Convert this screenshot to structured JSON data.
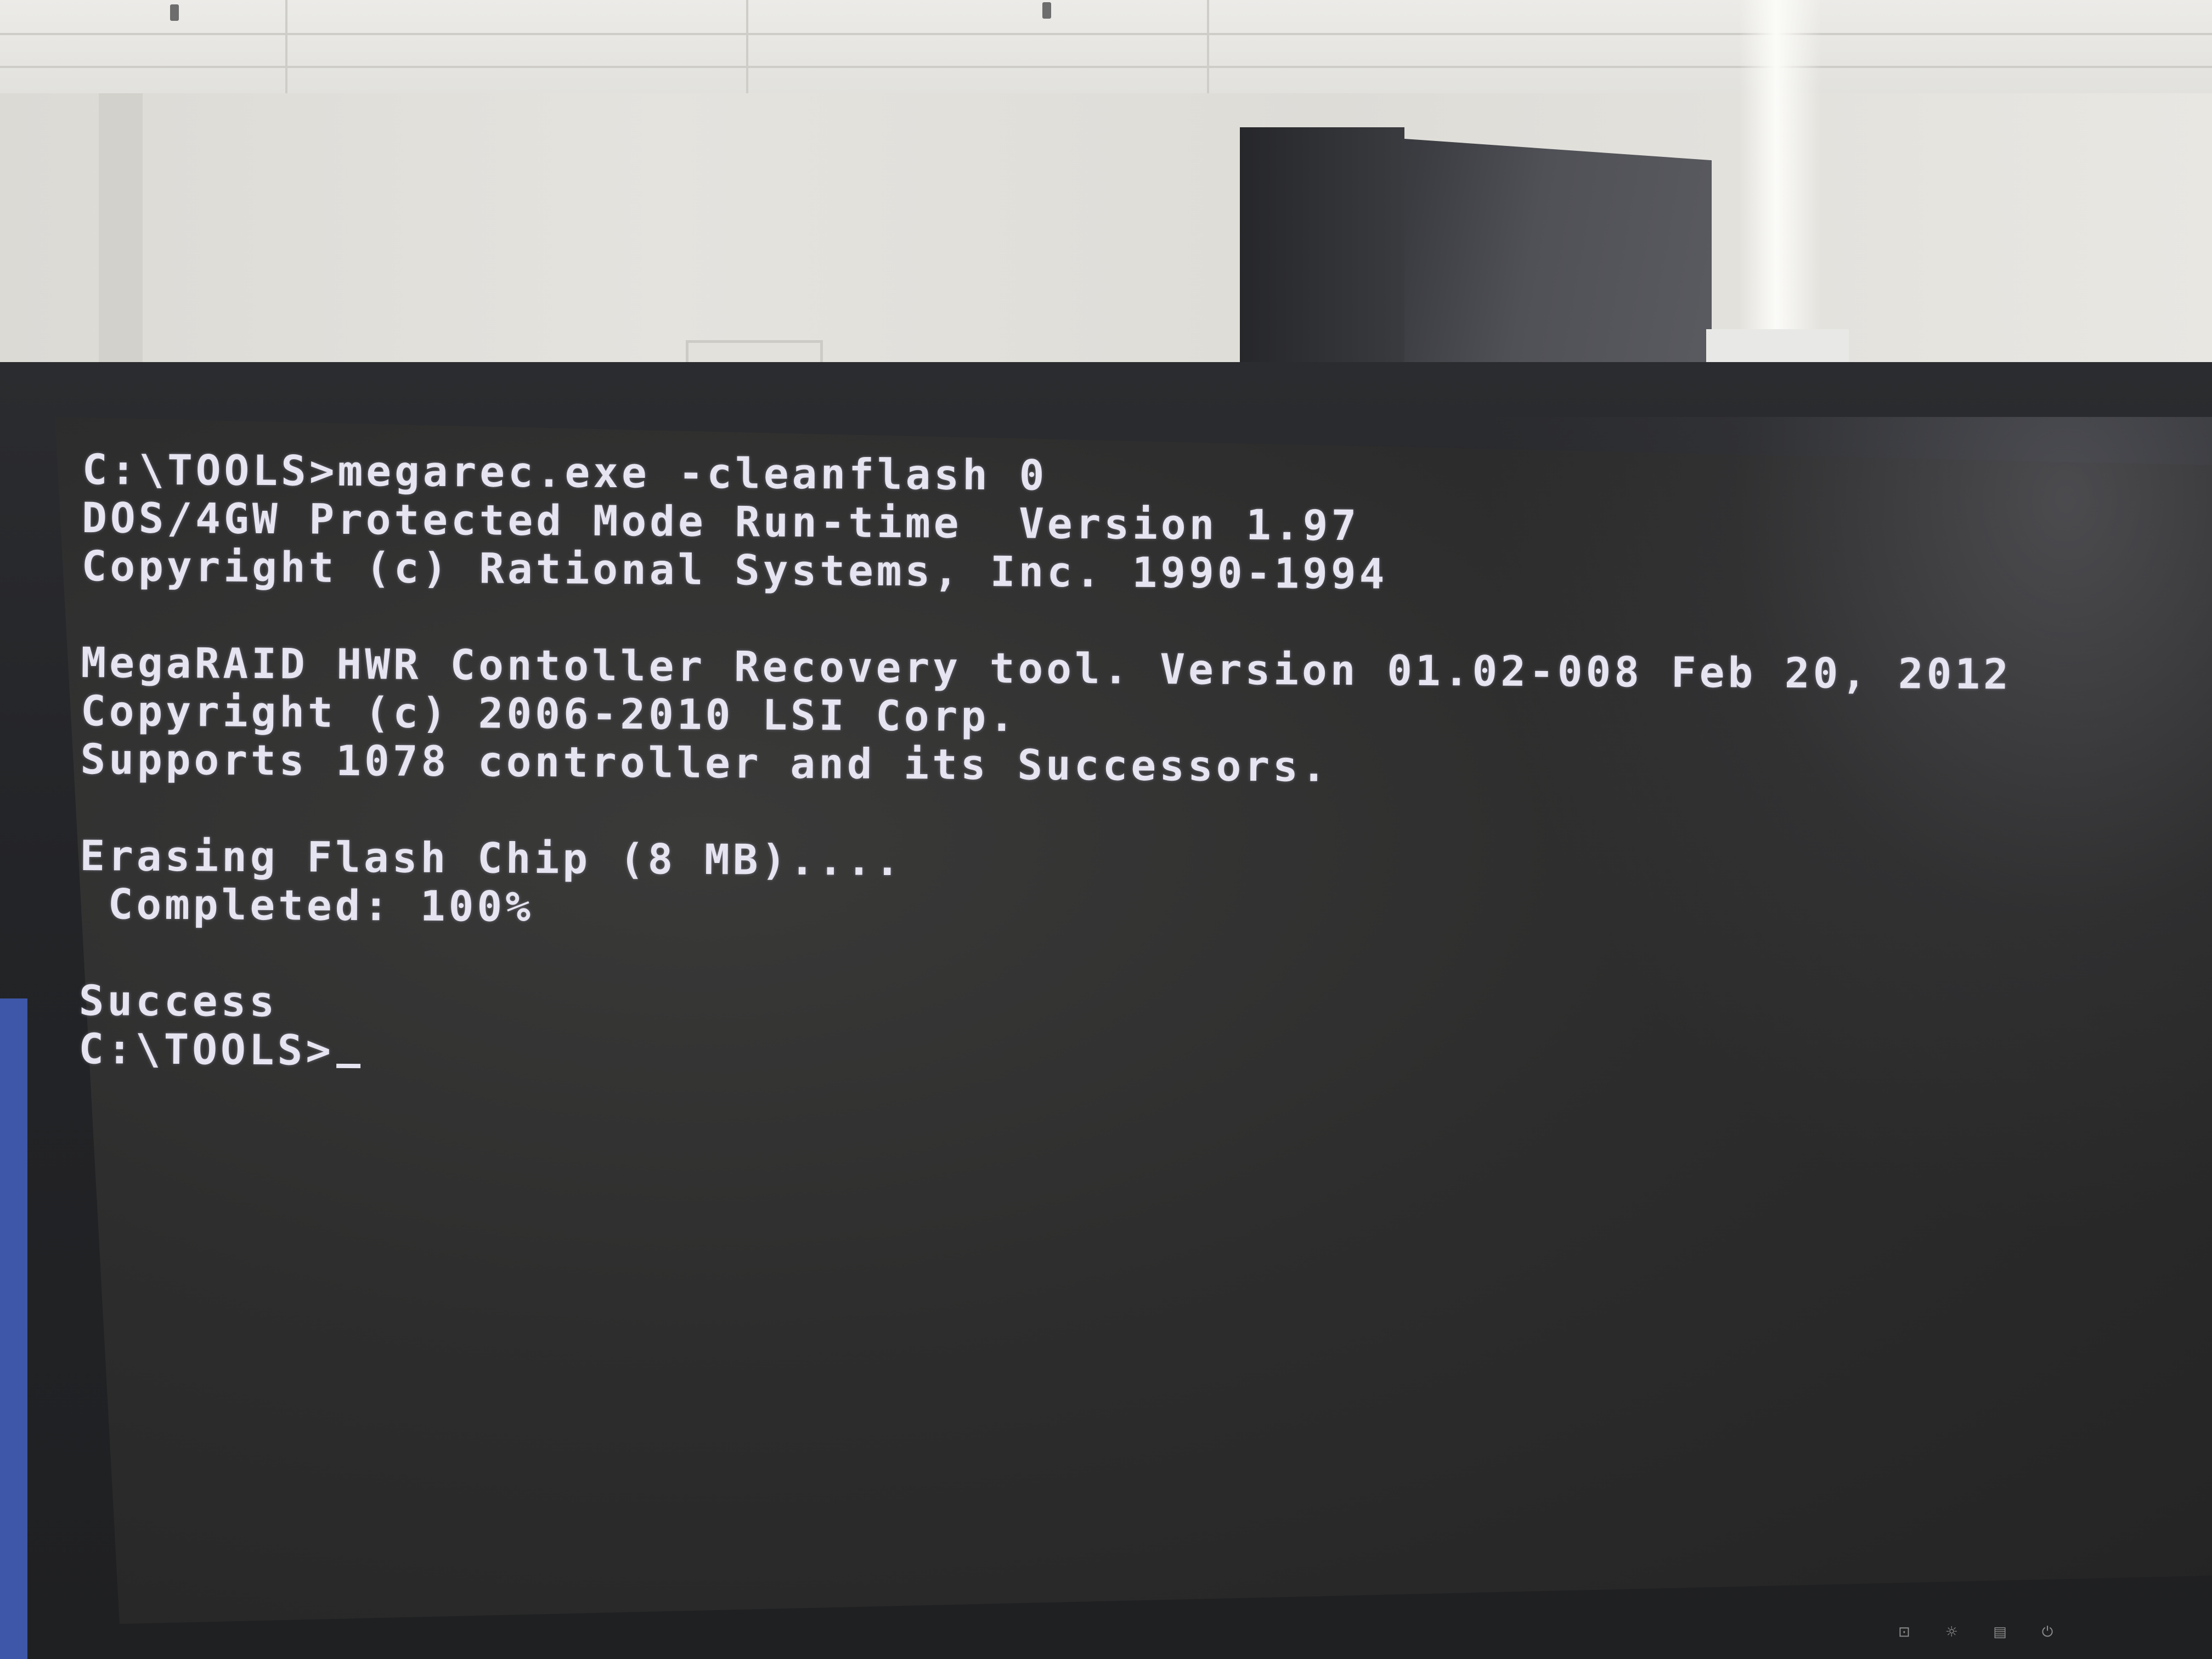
{
  "terminal": {
    "lines": [
      "C:\\TOOLS>megarec.exe -cleanflash 0",
      "DOS/4GW Protected Mode Run-time  Version 1.97",
      "Copyright (c) Rational Systems, Inc. 1990-1994",
      "",
      "MegaRAID HWR Contoller Recovery tool. Version 01.02-008 Feb 20, 2012",
      "Copyright (c) 2006-2010 LSI Corp.",
      "Supports 1078 controller and its Successors.",
      "",
      "Erasing Flash Chip (8 MB)....",
      " Completed: 100%",
      "",
      "Success"
    ],
    "prompt": "C:\\TOOLS>",
    "text_color": "#e6e4f0",
    "background_color": "#2d2d2d"
  },
  "monitor_controls": {
    "icons": [
      "input-icon",
      "brightness-icon",
      "menu-icon",
      "power-icon"
    ],
    "glyphs": [
      "⊡",
      "☼",
      "▤",
      "⏻"
    ]
  }
}
